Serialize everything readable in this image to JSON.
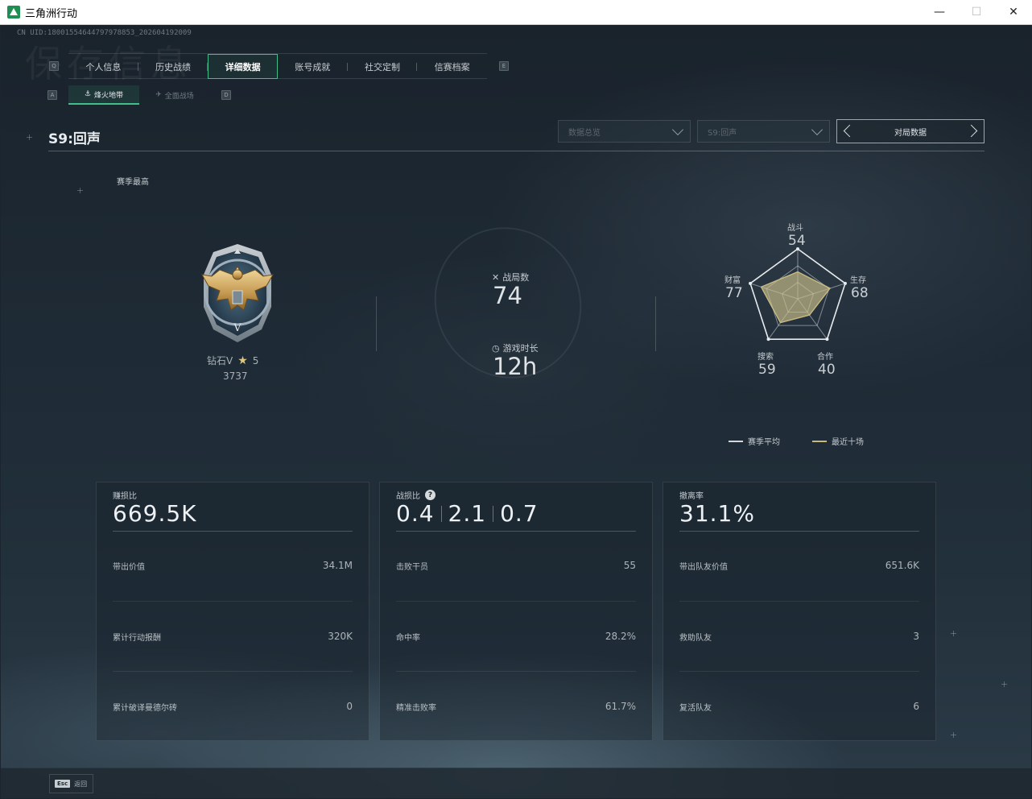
{
  "window": {
    "title": "三角洲行动",
    "controls": {
      "minimize": "—",
      "maximize": "☐",
      "close": "✕"
    }
  },
  "uid": "CN UID:18001554644797978853_202604192009",
  "background_text": "保存信息",
  "keycaps": {
    "prev_tab": "Q",
    "next_tab": "E",
    "prev_sub": "A",
    "next_sub": "D"
  },
  "tabs": [
    {
      "label": "个人信息"
    },
    {
      "label": "历史战绩"
    },
    {
      "label": "详细数据",
      "active": true
    },
    {
      "label": "账号成就"
    },
    {
      "label": "社交定制"
    },
    {
      "label": "信赛档案"
    }
  ],
  "subtabs": [
    {
      "label": "烽火地带",
      "icon": "fire-zone-icon",
      "active": true
    },
    {
      "label": "全面战场",
      "icon": "battlefield-icon"
    }
  ],
  "season_title": "S9:回声",
  "filters": {
    "overview": {
      "value": "数据总览"
    },
    "season": {
      "value": "S9:回声"
    },
    "switcher": {
      "label": "对局数据"
    }
  },
  "season_best_label": "赛季最高",
  "rank": {
    "name": "钻石V",
    "stars": "5",
    "score": "3737",
    "badge_icon": "diamond-eagle-badge-icon"
  },
  "stats": {
    "matches": {
      "label": "战局数",
      "value": "74",
      "icon": "crossed-swords-icon"
    },
    "playtime": {
      "label": "游戏时长",
      "value": "12h",
      "icon": "clock-icon"
    }
  },
  "radar": {
    "combat": {
      "label": "战斗",
      "value": "54"
    },
    "survival": {
      "label": "生存",
      "value": "68"
    },
    "cooperation": {
      "label": "合作",
      "value": "40"
    },
    "search": {
      "label": "搜索",
      "value": "59"
    },
    "wealth": {
      "label": "财富",
      "value": "77"
    },
    "series": {
      "season_avg": [
        0.54,
        0.68,
        0.4,
        0.59,
        0.77
      ],
      "recent_ten": [
        0.54,
        0.68,
        0.4,
        0.59,
        0.77
      ]
    },
    "colors": {
      "season_avg": "#d4d8db",
      "recent_ten": "#c9b97a"
    }
  },
  "legend": {
    "season_avg": "赛季平均",
    "recent_ten": "最近十场"
  },
  "cards": {
    "profit": {
      "title": "赚损比",
      "big": "669.5K",
      "rows": [
        {
          "label": "带出价值",
          "value": "34.1M"
        },
        {
          "label": "累计行动报酬",
          "value": "320K"
        },
        {
          "label": "累计破译曼德尔砖",
          "value": "0"
        }
      ]
    },
    "kd": {
      "title": "战损比",
      "help": "?",
      "values": [
        "0.4",
        "2.1",
        "0.7"
      ],
      "rows": [
        {
          "label": "击败干员",
          "value": "55"
        },
        {
          "label": "命中率",
          "value": "28.2%"
        },
        {
          "label": "精准击败率",
          "value": "61.7%"
        }
      ]
    },
    "extract": {
      "title": "撤离率",
      "big": "31.1%",
      "rows": [
        {
          "label": "带出队友价值",
          "value": "651.6K"
        },
        {
          "label": "救助队友",
          "value": "3"
        },
        {
          "label": "复活队友",
          "value": "6"
        }
      ]
    }
  },
  "bottom": {
    "esc_key": "Esc",
    "esc_label": "返回"
  }
}
